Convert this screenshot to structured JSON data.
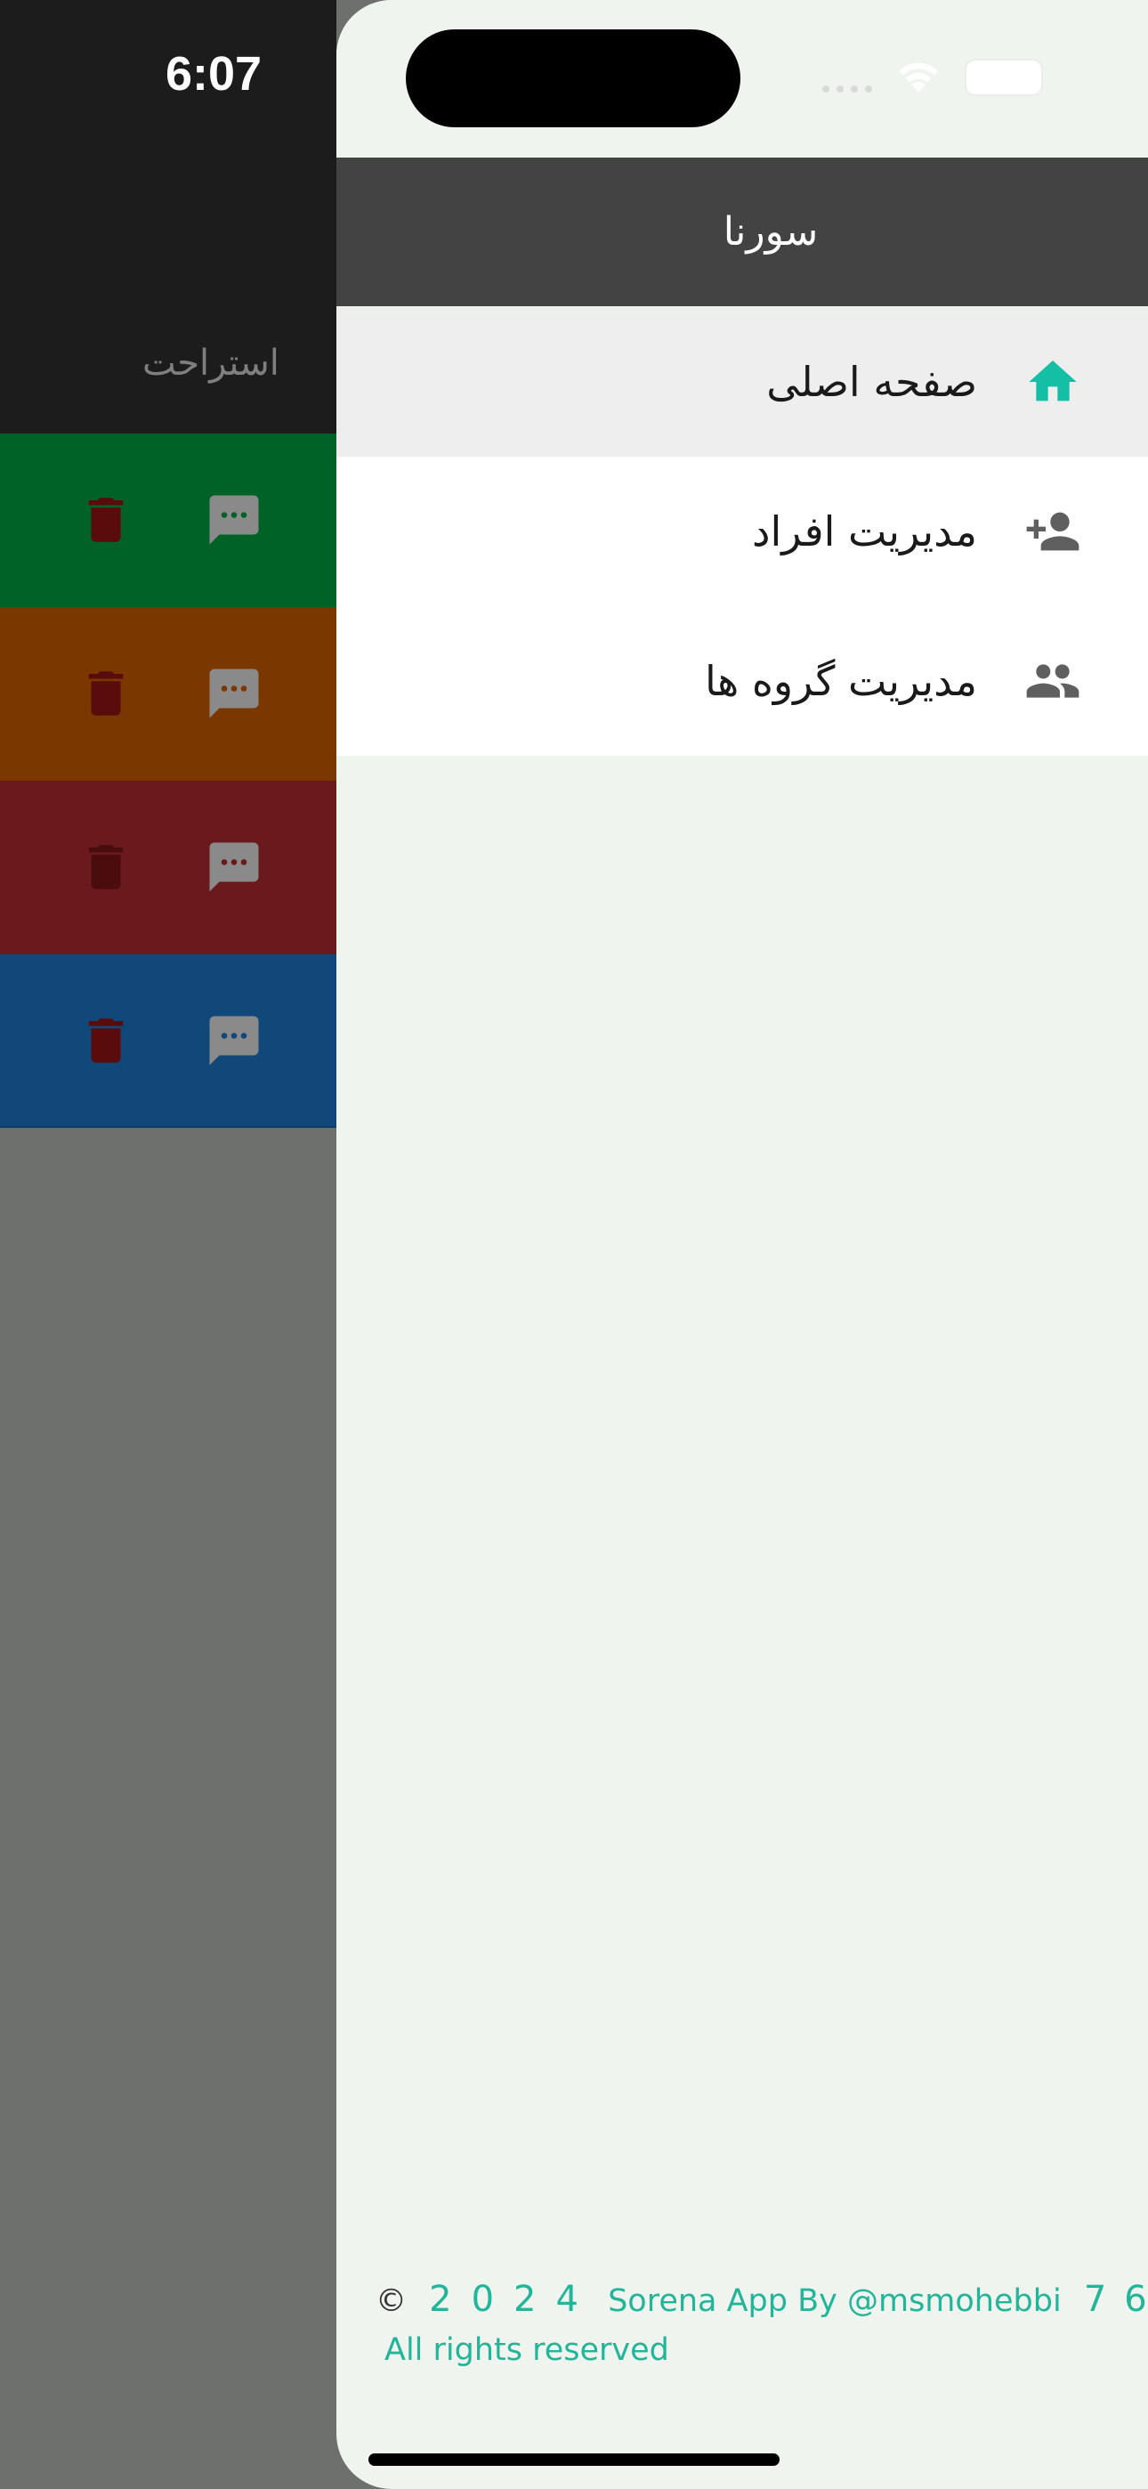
{
  "status_bar": {
    "time": "6:07"
  },
  "background_app": {
    "label": "استراحت",
    "rows": [
      {
        "color": "#006227"
      },
      {
        "color": "#7a3800"
      },
      {
        "color": "#6a1a1d"
      },
      {
        "color": "#10487a"
      }
    ]
  },
  "drawer": {
    "title": "سورنا",
    "menu": [
      {
        "label": "صفحه اصلی",
        "icon": "home-icon",
        "active": true
      },
      {
        "label": "مدیریت افراد",
        "icon": "person-add-icon",
        "active": false
      },
      {
        "label": "مدیریت گروه ها",
        "icon": "group-icon",
        "active": false
      }
    ],
    "footer": {
      "copyright_symbol": "©",
      "year": "2024",
      "text": "Sorena App By @msmohebbi",
      "suffix": "76",
      "rights": "All rights reserved"
    }
  },
  "colors": {
    "accent": "#14bfa6",
    "header": "#434343",
    "drawer_bg": "#eff4ee"
  }
}
